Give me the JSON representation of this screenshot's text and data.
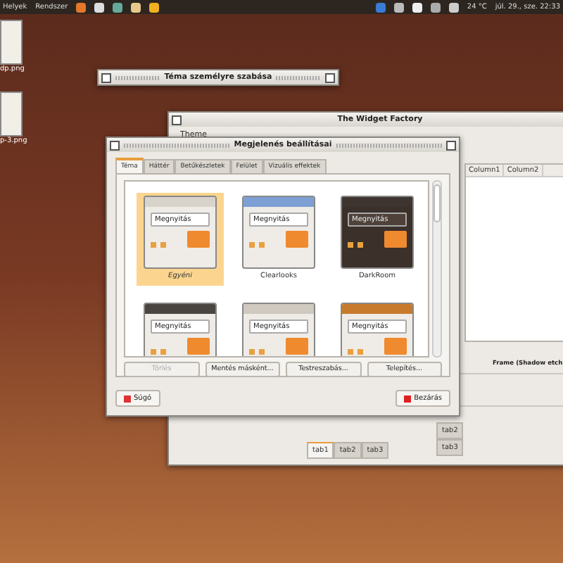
{
  "top_panel": {
    "menus": [
      "Helyek",
      "Rendszer"
    ],
    "weather": "24 °C",
    "clock": "júl. 29., sze. 22:33"
  },
  "desktop_icons": [
    {
      "label": "dp.png"
    },
    {
      "label": "p-3.png"
    }
  ],
  "customize_window": {
    "title": "Téma személyre szabása"
  },
  "widget_factory": {
    "title": "The Widget Factory",
    "menu": "Theme",
    "columns": [
      "Column1",
      "Column2"
    ],
    "frame_label": "Frame (Shadow etch",
    "tabs": [
      {
        "label": "tab1",
        "selected": true
      },
      {
        "label": "tab2",
        "selected": false
      },
      {
        "label": "tab3",
        "selected": false
      }
    ],
    "side_tabs": [
      "tab2",
      "tab3"
    ]
  },
  "dialog": {
    "title": "Megjelenés beállításai",
    "tabs": [
      {
        "label": "Téma",
        "selected": true
      },
      {
        "label": "Háttér",
        "selected": false
      },
      {
        "label": "Betűkészletek",
        "selected": false
      },
      {
        "label": "Felület",
        "selected": false
      },
      {
        "label": "Vizuális effektek",
        "selected": false
      }
    ],
    "themes": [
      {
        "name": "Egyéni",
        "preview_button": "Megnyitás",
        "color": "#d8d4cc",
        "dark": false,
        "selected": true
      },
      {
        "name": "Clearlooks",
        "preview_button": "Megnyitás",
        "color": "#7d9fd4",
        "dark": false,
        "selected": false
      },
      {
        "name": "DarkRoom",
        "preview_button": "Megnyitás",
        "color": "#3e3530",
        "dark": true,
        "selected": false
      },
      {
        "preview_button": "Megnyitás",
        "color": "#4a4540",
        "dark": false,
        "selected": false
      },
      {
        "preview_button": "Megnyitás",
        "color": "#cfc9c0",
        "dark": false,
        "selected": false
      },
      {
        "preview_button": "Megnyitás",
        "color": "#c87a2c",
        "dark": false,
        "selected": false
      }
    ],
    "actions": [
      {
        "label": "Törlés",
        "disabled": true
      },
      {
        "label": "Mentés másként...",
        "disabled": false
      },
      {
        "label": "Testreszabás...",
        "disabled": false
      },
      {
        "label": "Telepítés...",
        "disabled": false
      }
    ],
    "help": "Súgó",
    "close": "Bezárás"
  }
}
